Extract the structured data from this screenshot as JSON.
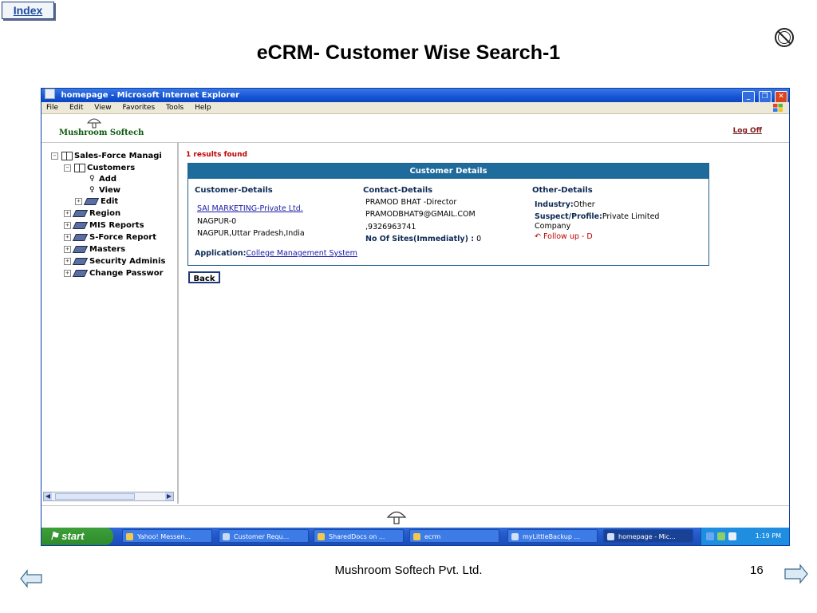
{
  "slide": {
    "index_label": "Index",
    "title": "eCRM- Customer Wise Search-1",
    "footer_company": "Mushroom Softech Pvt. Ltd.",
    "page_number": "16"
  },
  "window": {
    "title": "homepage - Microsoft Internet Explorer",
    "menu": [
      "File",
      "Edit",
      "View",
      "Favorites",
      "Tools",
      "Help"
    ]
  },
  "app": {
    "brand": "Mushroom Softech",
    "logoff_label": "Log Off"
  },
  "tree": {
    "root": "Sales-Force Managi",
    "customers": "Customers",
    "add": "Add",
    "view": "View",
    "edit": "Edit",
    "items": [
      "Region",
      "MIS Reports",
      "S-Force Report",
      "Masters",
      "Security Adminis",
      "Change Passwor"
    ]
  },
  "results": {
    "count_text": "1 results found",
    "panel_title": "Customer Details",
    "col_customer": "Customer-Details",
    "col_contact": "Contact-Details",
    "col_other": "Other-Details",
    "customer_name": "SAI MARKETING-Private Ltd.",
    "customer_line2": "NAGPUR-0",
    "customer_line3": "NAGPUR,Uttar Pradesh,India",
    "contact_name": "PRAMOD BHAT -Director",
    "contact_email": "PRAMODBHAT9@GMAIL.COM",
    "contact_phone": ",9326963741",
    "sites_label": "No Of Sites(Immediatly) :",
    "sites_value": "0",
    "industry_label": "Industry:",
    "industry_value": "Other",
    "suspect_label": "Suspect/Profile:",
    "suspect_value_line1": "Private Limited",
    "suspect_value_line2": "Company",
    "followup_label": "Follow up",
    "followup_suffix": "- D",
    "application_label": "Application:",
    "application_value": "College Management System",
    "back_label": "Back"
  },
  "taskbar": {
    "start_label": "start",
    "tasks": [
      "Yahoo! Messen...",
      "Customer Requ...",
      "SharedDocs on ...",
      "ecrm",
      "myLittleBackup ...",
      "homepage - Mic..."
    ],
    "clock": "1:19 PM"
  },
  "colors": {
    "ie_blue": "#1555d4",
    "panel_header": "#1f6c9c",
    "results_red": "#c00000",
    "brand_green": "#0a5a0a"
  }
}
